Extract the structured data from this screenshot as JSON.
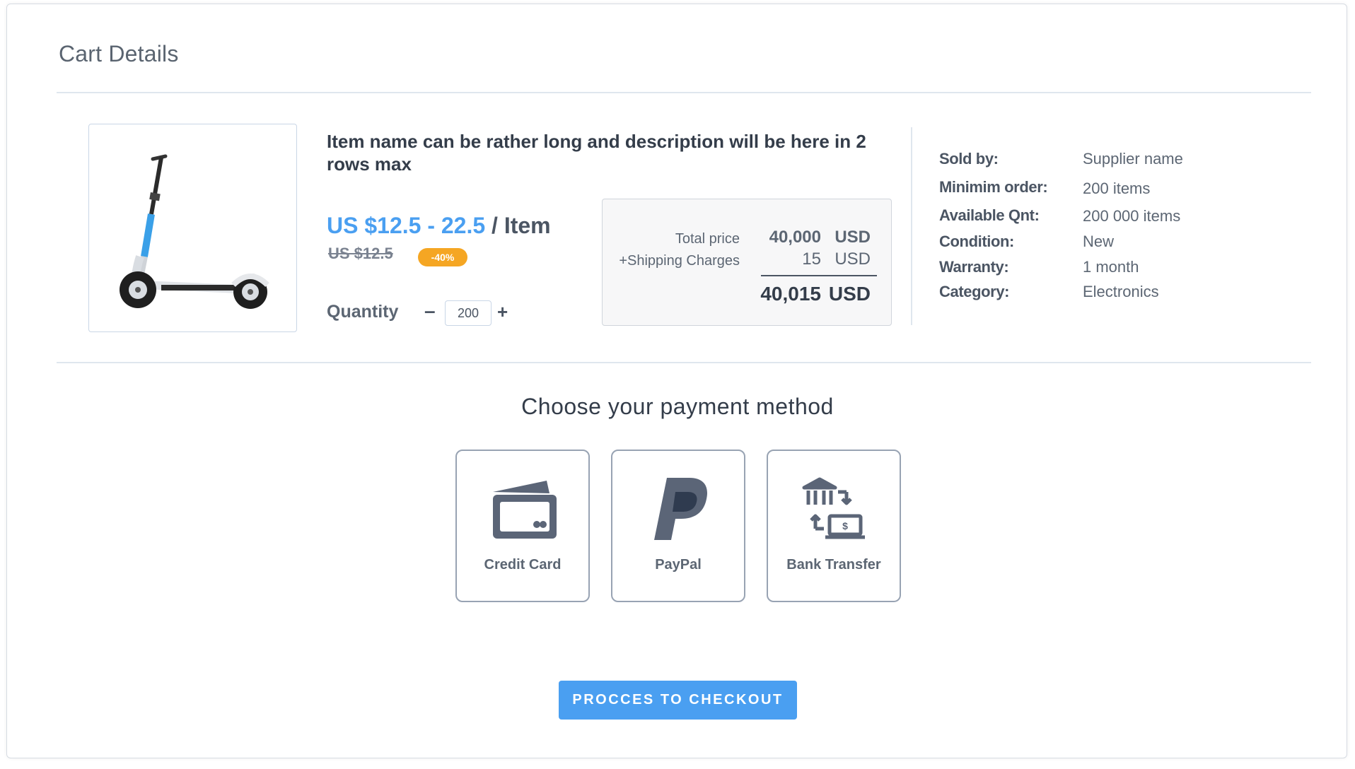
{
  "page": {
    "title": "Cart Details"
  },
  "item": {
    "name": "Item name can be rather long and description will be here in 2 rows max",
    "price_range": "US $12.5 - 22.5",
    "price_unit": "/ Item",
    "old_price": "US $12.5",
    "discount": "-40%",
    "quantity_label": "Quantity",
    "quantity": "200",
    "minus": "–",
    "plus": "+"
  },
  "totals": {
    "total_label": "Total price",
    "total_value": "40,000",
    "total_currency": "USD",
    "shipping_label": "+Shipping Charges",
    "shipping_value": "15",
    "shipping_currency": "USD",
    "grand_total": "40,015",
    "grand_currency": "USD"
  },
  "details": [
    {
      "label": "Sold by:",
      "value": "Supplier name"
    },
    {
      "label": "Minimim order:",
      "value": "200 items"
    },
    {
      "label": "Available Qnt:",
      "value": "200 000 items"
    },
    {
      "label": "Condition:",
      "value": "New"
    },
    {
      "label": "Warranty:",
      "value": "1 month"
    },
    {
      "label": "Category:",
      "value": "Electronics"
    }
  ],
  "payment": {
    "heading": "Choose your payment method",
    "methods": [
      {
        "label": "Credit Card",
        "icon": "credit-card-icon"
      },
      {
        "label": "PayPal",
        "icon": "paypal-icon"
      },
      {
        "label": "Bank Transfer",
        "icon": "bank-transfer-icon"
      }
    ]
  },
  "checkout": {
    "label": "PROCCES TO CHECKOUT"
  },
  "colors": {
    "accent": "#4a9ff1",
    "badge": "#f5a623",
    "text": "#343d4a",
    "muted": "#5c6673"
  }
}
